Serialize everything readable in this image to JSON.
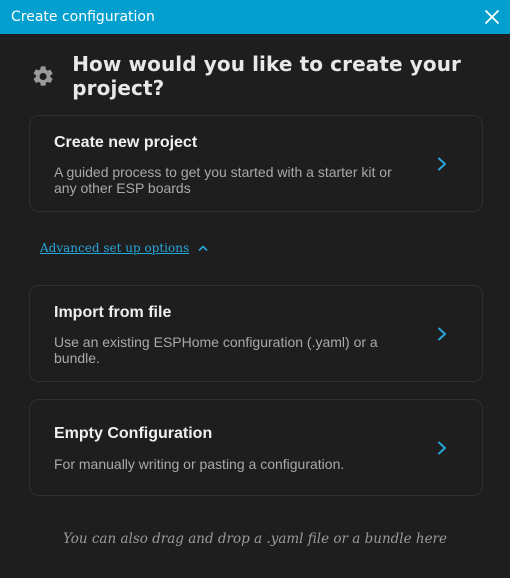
{
  "dialog": {
    "title": "Create configuration",
    "close_icon": "close-icon"
  },
  "heading": {
    "icon": "gear-icon",
    "text": "How would you like to create your project?"
  },
  "options": [
    {
      "title": "Create new project",
      "description": "A guided process to get you started with a starter kit or any other ESP boards",
      "icon": "chevron-right-icon"
    },
    {
      "title": "Import from file",
      "description": "Use an existing ESPHome configuration (.yaml) or a bundle.",
      "icon": "chevron-right-icon"
    },
    {
      "title": "Empty Configuration",
      "description": "For manually writing or pasting a configuration.",
      "icon": "chevron-right-icon"
    }
  ],
  "advanced": {
    "label": "Advanced set up options",
    "icon": "chevron-up-icon"
  },
  "hint": "You can also drag and drop a .yaml file or a bundle here",
  "colors": {
    "titlebar": "#039fcf",
    "background": "#1e1e1f",
    "accent": "#27a7da",
    "card_border": "#2c3033"
  }
}
